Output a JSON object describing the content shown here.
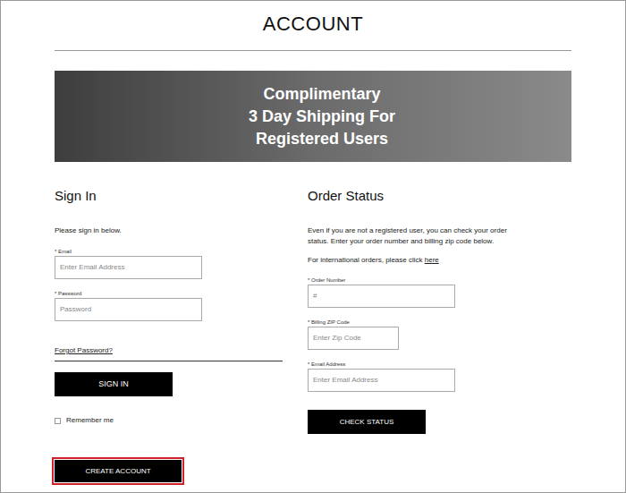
{
  "page": {
    "title": "ACCOUNT"
  },
  "banner": {
    "lines": [
      "Complimentary",
      "3 Day Shipping For",
      "Registered Users"
    ]
  },
  "sign_in": {
    "heading": "Sign In",
    "instructions": "Please sign in below.",
    "fields": [
      {
        "label": "* Email",
        "placeholder": "Enter Email Address",
        "type": "email"
      },
      {
        "label": "* Password",
        "placeholder": "Password",
        "type": "password"
      }
    ],
    "forgot_link": "Forgot Password?",
    "button": "SIGN IN",
    "remember": {
      "label": "Remember me",
      "checked": false
    },
    "create_button": {
      "label": "CREATE ACCOUNT",
      "highlighted": true
    }
  },
  "order_status": {
    "heading": "Order Status",
    "description": "Even if you are not a registered user, you can check your order status. Enter your order number and billing zip code below.",
    "intl_text": "For international orders, please click ",
    "intl_link": "here",
    "fields": [
      {
        "label": "* Order Number",
        "placeholder": "#",
        "width": "wide"
      },
      {
        "label": "* Billing ZIP Code",
        "placeholder": "Enter Zip Code",
        "width": "narrow"
      },
      {
        "label": "* Email Address",
        "placeholder": "Enter Email Address",
        "width": "wide"
      }
    ],
    "button": "CHECK STATUS"
  }
}
